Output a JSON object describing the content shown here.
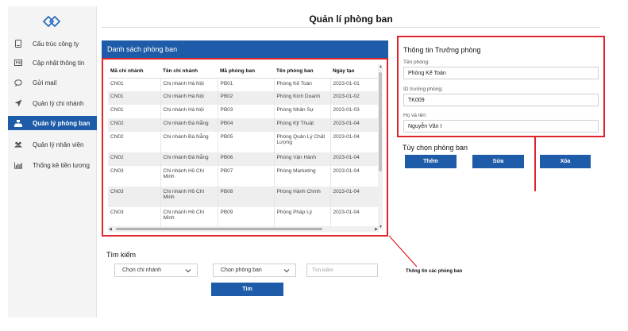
{
  "sidebar": {
    "items": [
      {
        "label": "Cấu trúc công ty",
        "icon": "phone-icon"
      },
      {
        "label": "Cập nhật thông tin",
        "icon": "id-card-icon"
      },
      {
        "label": "Gửi mail",
        "icon": "chat-bubble-icon"
      },
      {
        "label": "Quản lý chi nhánh",
        "icon": "send-arrow-icon"
      },
      {
        "label": "Quản lý phòng ban",
        "icon": "hierarchy-icon"
      },
      {
        "label": "Quản lý nhân viên",
        "icon": "users-icon"
      },
      {
        "label": "Thống kê tiền lương",
        "icon": "bar-chart-icon"
      }
    ],
    "active_index": 4
  },
  "main": {
    "title": "Quản lí phòng ban"
  },
  "department_list": {
    "header": "Danh sách phòng ban",
    "columns": [
      "Mã chi nhánh",
      "Tên chi nhánh",
      "Mã phòng ban",
      "Tên phòng ban",
      "Ngày tạo"
    ],
    "rows": [
      [
        "CN01",
        "Chi nhánh Hà Nội",
        "PB01",
        "Phòng Kế Toán",
        "2023-01-01"
      ],
      [
        "CN01",
        "Chi nhánh Hà Nội",
        "PB02",
        "Phòng Kinh Doanh",
        "2023-01-02"
      ],
      [
        "CN01",
        "Chi nhánh Hà Nội",
        "PB03",
        "Phòng Nhân Sự",
        "2023-01-03"
      ],
      [
        "CN02",
        "Chi nhánh Đà Nẵng",
        "PB04",
        "Phòng Kỹ Thuật",
        "2023-01-04"
      ],
      [
        "CN02",
        "Chi nhánh Đà Nẵng",
        "PB05",
        "Phòng Quản Lý Chất Lượng",
        "2023-01-04"
      ],
      [
        "CN02",
        "Chi nhánh Đà Nẵng",
        "PB06",
        "Phòng Vận Hành",
        "2023-01-04"
      ],
      [
        "CN03",
        "Chi nhánh Hồ Chí Minh",
        "PB07",
        "Phòng Marketing",
        "2023-01-04"
      ],
      [
        "CN03",
        "Chi nhánh Hồ Chí Minh",
        "PB08",
        "Phòng Hành Chính",
        "2023-01-04"
      ],
      [
        "CN03",
        "Chi nhánh Hồ Chí Minh",
        "PB09",
        "Phòng Pháp Lý",
        "2023-01-04"
      ]
    ]
  },
  "manager_info": {
    "title": "Thông tin Trưởng phòng",
    "department_label": "Tên phòng:",
    "department_value": "Phòng Kế Toán",
    "manager_id_label": "ID trưởng phòng:",
    "manager_id_value": "TK009",
    "full_name_label": "Họ và tên:",
    "full_name_value": "Nguyễn Văn I"
  },
  "options": {
    "title": "Tùy chọn phòng ban",
    "add_label": "Thêm",
    "edit_label": "Sửa",
    "delete_label": "Xóa"
  },
  "annotation": {
    "text": "Thông tin các phòng ban"
  },
  "search": {
    "title": "Tìm kiếm",
    "branch_select": "Chọn chi nhánh",
    "department_select": "Chọn phòng ban",
    "keyword_placeholder": "Tìm kiếm",
    "search_label": "Tìm"
  },
  "colors": {
    "accent": "#1e5ba8",
    "highlight": "#e0242c"
  }
}
